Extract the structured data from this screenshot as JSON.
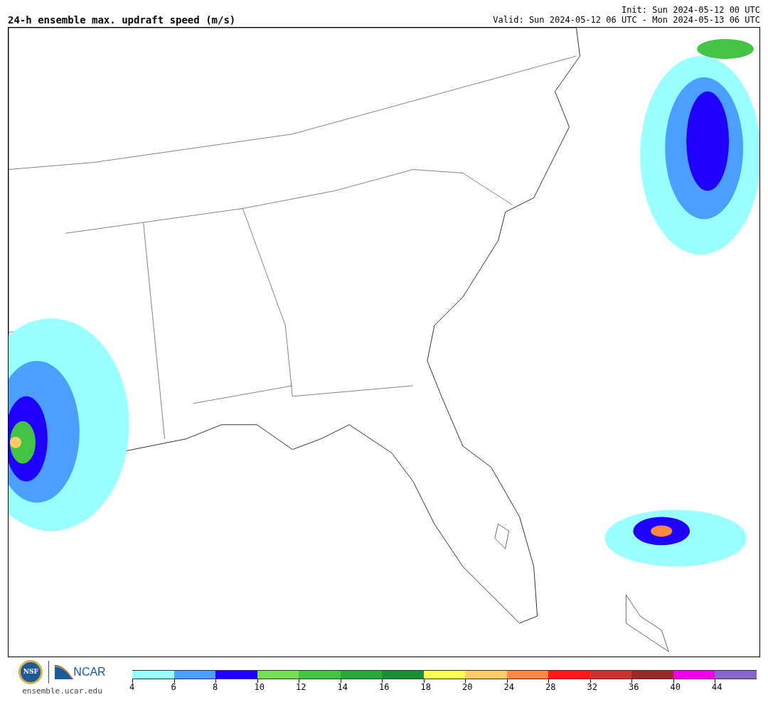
{
  "title": "24-h ensemble max. updraft speed (m/s)",
  "init": "Init: Sun 2024-05-12 00 UTC",
  "valid": "Valid: Sun 2024-05-12 06 UTC - Mon 2024-05-13 06 UTC",
  "footer": {
    "nsf_logo": "NSF",
    "ncar_logo": "NCAR",
    "url": "ensemble.ucar.edu"
  },
  "colorbar": [
    {
      "label": "4",
      "color": "#99ffff"
    },
    {
      "label": "6",
      "color": "#4d9fff"
    },
    {
      "label": "8",
      "color": "#1f00ff"
    },
    {
      "label": "10",
      "color": "#77dd55"
    },
    {
      "label": "12",
      "color": "#44c444"
    },
    {
      "label": "14",
      "color": "#2aaa3a"
    },
    {
      "label": "16",
      "color": "#1a8f35"
    },
    {
      "label": "18",
      "color": "#ffff55"
    },
    {
      "label": "20",
      "color": "#ffcc66"
    },
    {
      "label": "24",
      "color": "#ff8844"
    },
    {
      "label": "28",
      "color": "#ff1a1a"
    },
    {
      "label": "32",
      "color": "#cc3333"
    },
    {
      "label": "36",
      "color": "#992a2a"
    },
    {
      "label": "40",
      "color": "#ee00ee"
    },
    {
      "label": "44",
      "color": "#8866cc"
    }
  ]
}
